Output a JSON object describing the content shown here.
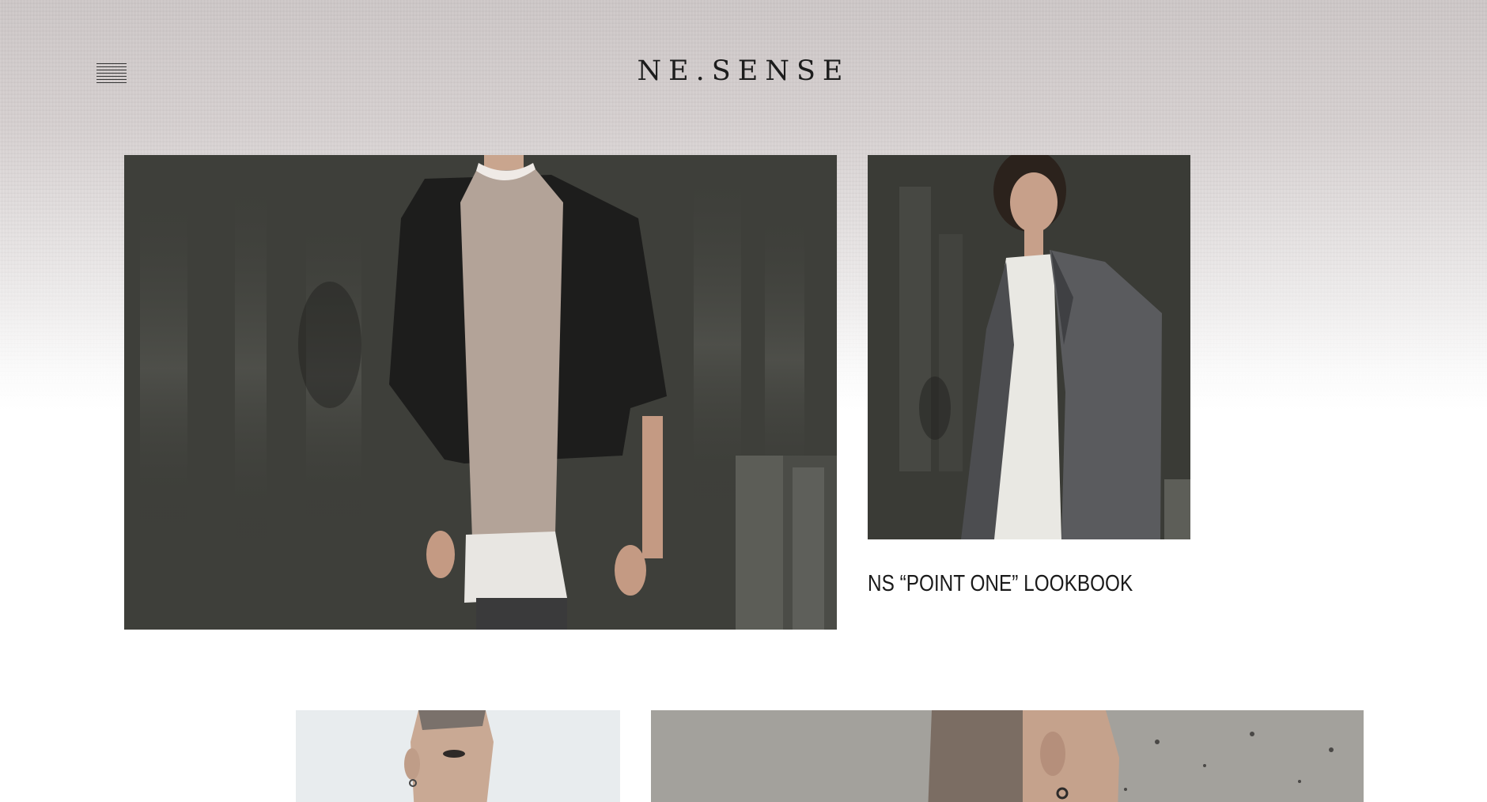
{
  "header": {
    "logo_text": "NE.SENSE",
    "menu_icon": "hamburger-menu-icon"
  },
  "featured": {
    "main_photo": "model-black-kimono-photo",
    "side_photo": "model-grey-coat-photo",
    "title": "NS “POINT ONE” LOOKBOOK"
  },
  "next_row": {
    "left_photo": "model-portrait-photo",
    "right_photo": "model-concrete-wall-photo"
  },
  "colors": {
    "text": "#1a1a1a",
    "header_bg": "#cdc7c7",
    "page_bg": "#ffffff"
  }
}
